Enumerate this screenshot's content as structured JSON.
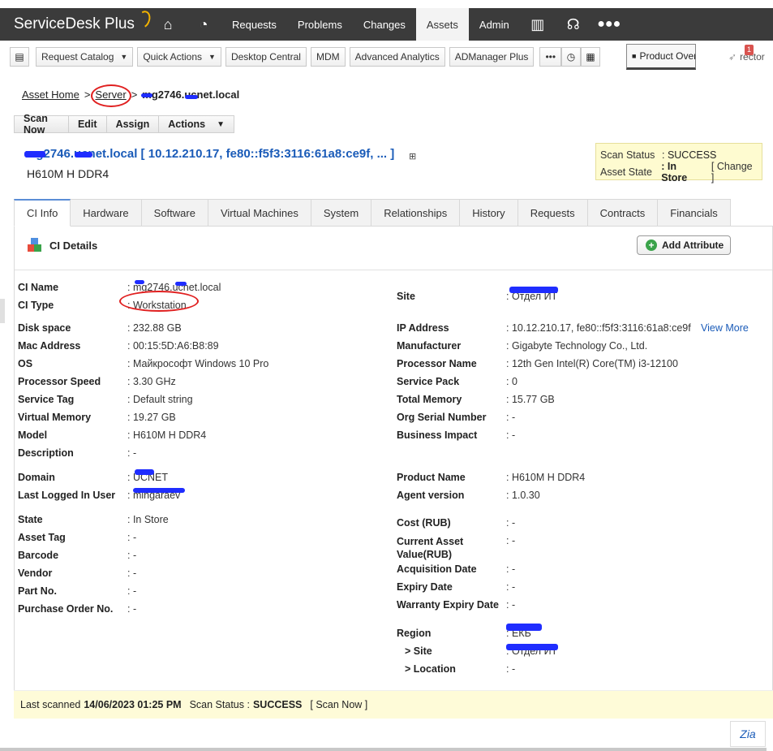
{
  "app": {
    "logo_main": "ServiceDesk",
    "logo_plus": " Plus"
  },
  "nav": {
    "items": [
      "Requests",
      "Problems",
      "Changes",
      "Assets",
      "Admin"
    ],
    "active": "Assets"
  },
  "toolbar": {
    "request_catalog": "Request Catalog",
    "quick_actions": "Quick Actions",
    "desktop_central": "Desktop Central",
    "mdm": "MDM",
    "advanced_analytics": "Advanced Analytics",
    "admanager_plus": "ADManager Plus",
    "more": "•••",
    "product_overview": "Product Overview",
    "director": "rector",
    "badge": "1"
  },
  "breadcrumb": {
    "home": "Asset Home",
    "server": "Server",
    "current": "mg2746.ucnet.local"
  },
  "actions": {
    "scan_now": "Scan Now",
    "edit": "Edit",
    "assign": "Assign",
    "actions": "Actions"
  },
  "ci": {
    "title": "mg2746.ucnet.local [ 10.12.210.17, fe80::f5f3:3116:61a8:ce9f, ... ]",
    "model": "H610M H DDR4"
  },
  "status": {
    "scan_status_label": "Scan Status",
    "scan_status_value": ": SUCCESS",
    "asset_state_label": "Asset State",
    "asset_state_value": ": In Store",
    "change": "[ Change ]"
  },
  "tabs": [
    "CI Info",
    "Hardware",
    "Software",
    "Virtual Machines",
    "System",
    "Relationships",
    "History",
    "Requests",
    "Contracts",
    "Financials"
  ],
  "details": {
    "heading": "CI Details",
    "add_attribute": "Add Attribute",
    "left": [
      {
        "k": "CI Name",
        "v": ": mg2746.ucnet.local"
      },
      {
        "k": "CI Type",
        "v": ": Workstation"
      },
      {
        "k": "Disk space",
        "v": ": 232.88 GB"
      },
      {
        "k": "Mac Address",
        "v": ": 00:15:5D:A6:B8:89"
      },
      {
        "k": "OS",
        "v": ": Майкрософт Windows 10 Pro"
      },
      {
        "k": "Processor Speed",
        "v": ": 3.30 GHz"
      },
      {
        "k": "Service Tag",
        "v": ": Default string"
      },
      {
        "k": "Virtual Memory",
        "v": ": 19.27 GB"
      },
      {
        "k": "Model",
        "v": ": H610M H DDR4"
      },
      {
        "k": "Description",
        "v": ": -"
      },
      {
        "k": "Domain",
        "v": ": UCNET"
      },
      {
        "k": "Last Logged In User",
        "v": ": mingaraev"
      },
      {
        "k": "State",
        "v": ": In Store"
      },
      {
        "k": "Asset Tag",
        "v": ": -"
      },
      {
        "k": "Barcode",
        "v": ": -"
      },
      {
        "k": "Vendor",
        "v": ": -"
      },
      {
        "k": "Part No.",
        "v": ": -"
      },
      {
        "k": "Purchase Order No.",
        "v": ": -"
      }
    ],
    "right": [
      {
        "k": "Site",
        "v": ": Отдел ИТ"
      },
      {
        "k": "IP Address",
        "v": ": 10.12.210.17, fe80::f5f3:3116:61a8:ce9f"
      },
      {
        "k": "Manufacturer",
        "v": ": Gigabyte Technology Co., Ltd."
      },
      {
        "k": "Processor Name",
        "v": ": 12th Gen Intel(R) Core(TM) i3-12100"
      },
      {
        "k": "Service Pack",
        "v": ": 0"
      },
      {
        "k": "Total Memory",
        "v": ": 15.77 GB"
      },
      {
        "k": "Org Serial Number",
        "v": ": -"
      },
      {
        "k": "Business Impact",
        "v": ": -"
      },
      {
        "k": "Product Name",
        "v": ": H610M H DDR4"
      },
      {
        "k": "Agent version",
        "v": ": 1.0.30"
      },
      {
        "k": "Cost (RUB)",
        "v": ": -"
      },
      {
        "k": "Current Asset Value(RUB)",
        "v": ": -"
      },
      {
        "k": "Acquisition Date",
        "v": ": -"
      },
      {
        "k": "Expiry Date",
        "v": ": -"
      },
      {
        "k": "Warranty Expiry Date",
        "v": ": -"
      },
      {
        "k": "Region",
        "v": ": ЕКБ"
      },
      {
        "k": "> Site",
        "v": ": Отдел ИТ"
      },
      {
        "k": "> Location",
        "v": ": -"
      }
    ],
    "view_more": "View More"
  },
  "footer": {
    "last_scanned_label": "Last scanned",
    "last_scanned_value": "14/06/2023 01:25 PM",
    "scan_status_label": "Scan Status :",
    "scan_status_value": "SUCCESS",
    "scan_now": "[ Scan Now ]"
  },
  "zia": "Zia"
}
